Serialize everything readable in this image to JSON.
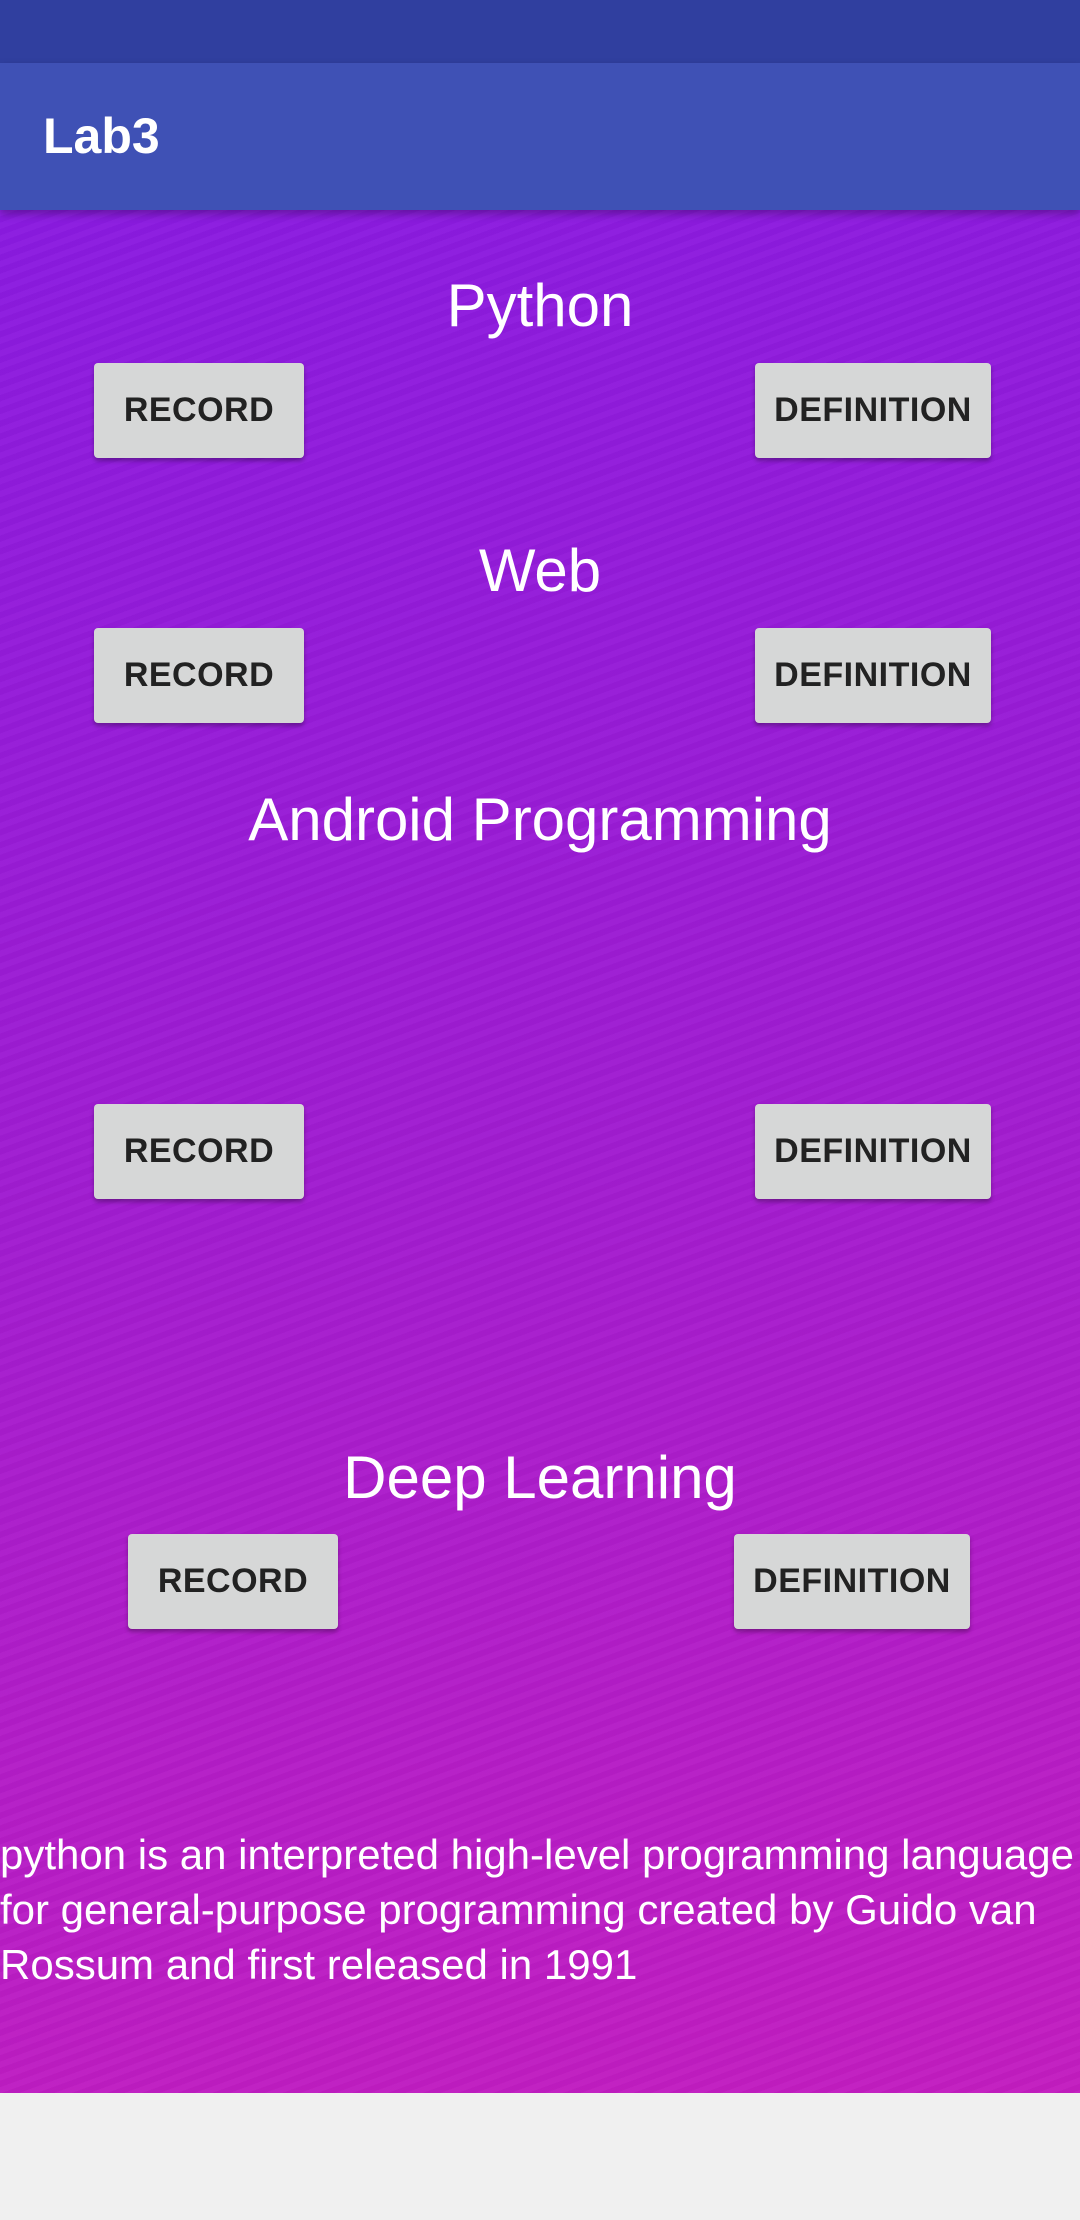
{
  "app": {
    "title": "Lab3",
    "colors": {
      "status_bar": "#303f9f",
      "app_bar": "#3f51b5",
      "gradient_top": "#8a1be0",
      "gradient_bottom": "#c31dc0",
      "button": "#d6d7d7"
    }
  },
  "topics": [
    {
      "title": "Python",
      "record_label": "RECORD",
      "definition_label": "DEFINITION"
    },
    {
      "title": "Web",
      "record_label": "RECORD",
      "definition_label": "DEFINITION"
    },
    {
      "title": "Android Programming",
      "record_label": "RECORD",
      "definition_label": "DEFINITION"
    },
    {
      "title": "Deep Learning",
      "record_label": "RECORD",
      "definition_label": "DEFINITION"
    }
  ],
  "definition": {
    "text": "python is an interpreted high-level programming language for general-purpose programming created by Guido van Rossum and first released in 1991"
  }
}
